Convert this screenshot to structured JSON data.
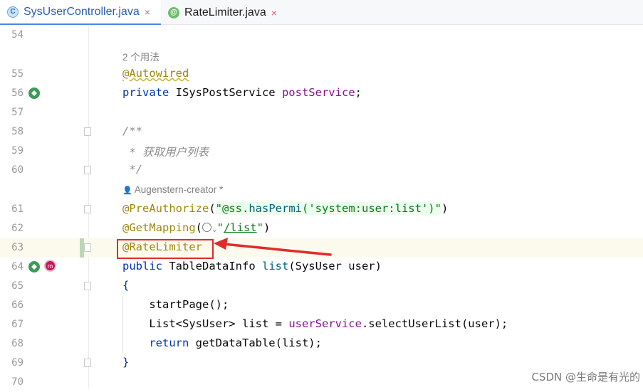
{
  "tabs": [
    {
      "icon": "C",
      "label": "SysUserController.java",
      "close": "×"
    },
    {
      "icon": "@",
      "label": "RateLimiter.java",
      "close": "×"
    }
  ],
  "lines": {
    "l54": "54",
    "l55": "55",
    "l56": "56",
    "l57": "57",
    "l58": "58",
    "l59": "59",
    "l60": "60",
    "l61": "61",
    "l62": "62",
    "l63": "63",
    "l64": "64",
    "l65": "65",
    "l66": "66",
    "l67": "67",
    "l68": "68",
    "l69": "69",
    "l70": "70"
  },
  "hints": {
    "usages": "2 个用法",
    "author_icon": "👤",
    "author": "Augenstern-creator *"
  },
  "code": {
    "autowired": "@Autowired",
    "private_kw": "private",
    "post_type": " ISysPostService ",
    "post_field": "postService",
    "semi": ";",
    "doc_open": "/**",
    "doc_body": " * 获取用户列表",
    "doc_close": " */",
    "pre_auth": "@PreAuthorize",
    "pre_open": "(",
    "pre_str1": "\"@ss.",
    "pre_method": "hasPermi",
    "pre_str2": "('system:user:list')\"",
    "pre_close": ")",
    "get_mapping": "@GetMapping",
    "gm_open": "(",
    "gm_chev": "⌄",
    "gm_str1": "\"",
    "gm_path": "/list",
    "gm_str2": "\"",
    "gm_close": ")",
    "rate_limiter": "@RateLimiter",
    "public_kw": "public",
    "tdi": " TableDataInfo ",
    "list_m": "list",
    "params": "(SysUser user)",
    "brace_open": "{",
    "start_page": "    startPage();",
    "list_decl": "    List",
    "list_generic": "<SysUser>",
    "list_assign": " list = ",
    "user_service": "userService",
    "select_call": ".selectUserList(user);",
    "return_kw": "    return",
    "return_rest": " getDataTable(list);",
    "brace_close": "}"
  },
  "watermark": "CSDN @生命是有光的",
  "colors": {
    "annotation": "#9e880d",
    "keyword": "#0033b3",
    "field": "#871094",
    "string": "#067d17",
    "comment": "#8c8c8c",
    "highlight_box": "#e02b2b"
  }
}
